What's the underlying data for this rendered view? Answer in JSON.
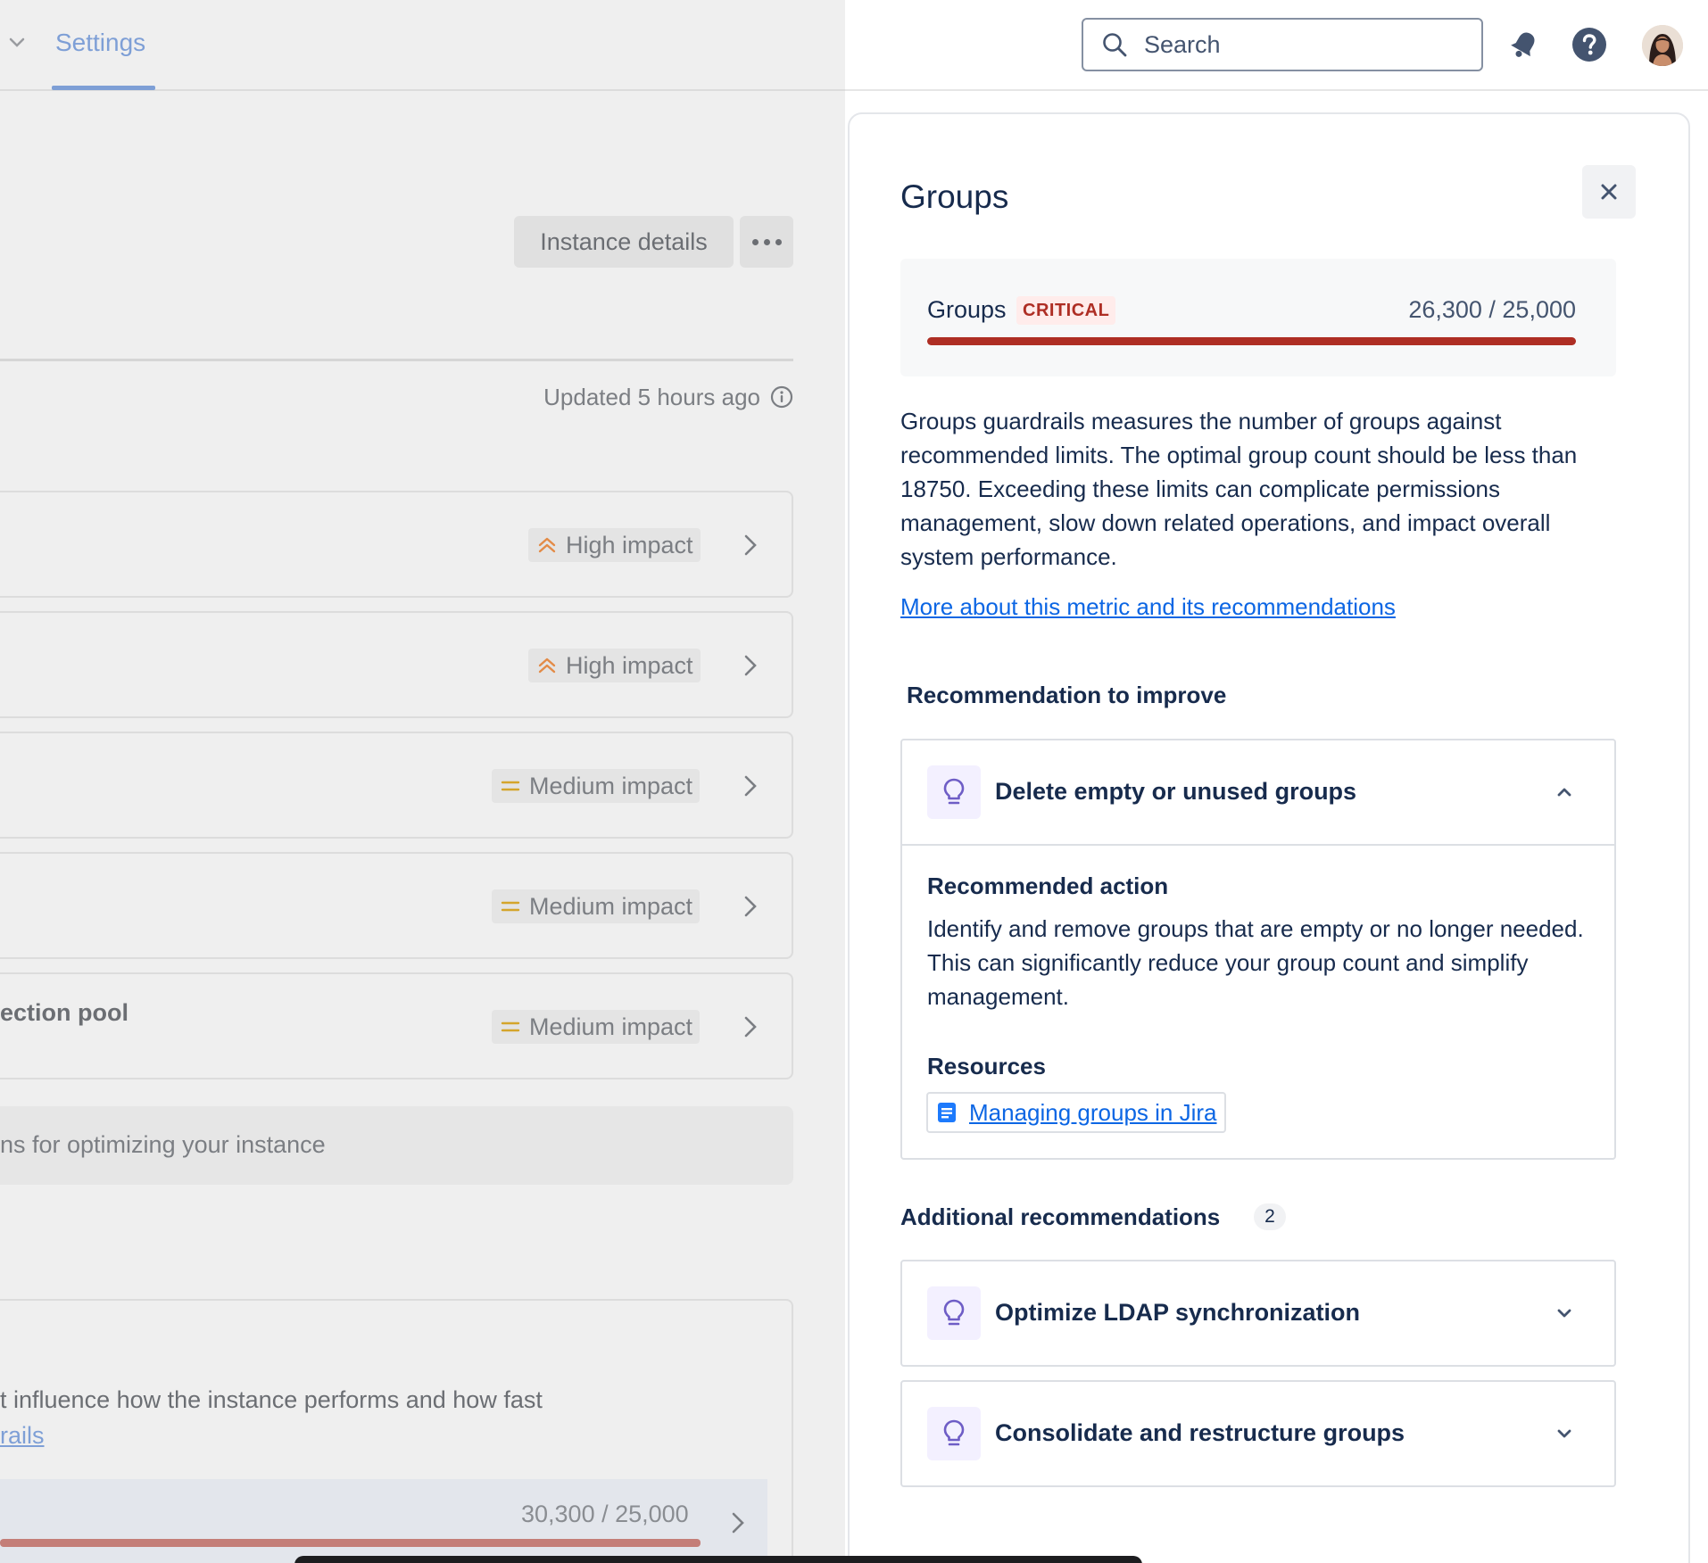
{
  "left_page": {
    "nav_tab": "Settings",
    "instance_details_button": "Instance details",
    "updated_text": "Updated 5 hours ago",
    "rows": [
      {
        "title": "",
        "impact": "High impact",
        "impact_level": "high"
      },
      {
        "title": "",
        "impact": "High impact",
        "impact_level": "high"
      },
      {
        "title": "",
        "impact": "Medium impact",
        "impact_level": "medium"
      },
      {
        "title": "",
        "impact": "Medium impact",
        "impact_level": "medium"
      },
      {
        "title": "ection pool",
        "impact": "Medium impact",
        "impact_level": "medium"
      }
    ],
    "tip_text": "ns for optimizing your instance",
    "bottom_text": "t influence how the instance performs and how fast",
    "bottom_link": "rails",
    "metric_value": "30,300 / 25,000",
    "metric_progress": 1.0
  },
  "header": {
    "search_placeholder": "Search",
    "icons": [
      "search-icon",
      "notification-bell-icon",
      "help-icon",
      "user-avatar"
    ]
  },
  "panel": {
    "title": "Groups",
    "metric": {
      "label": "Groups",
      "status": "CRITICAL",
      "value": "26,300 / 25,000",
      "progress": 1.0,
      "status_color": "#ae2e24"
    },
    "description": "Groups guardrails measures the number of groups against recommended limits. The optimal group count should be less than 18750. Exceeding these limits can complicate permissions management, slow down related operations, and impact overall system performance.",
    "more_link": "More about this metric and its recommendations",
    "recommendation_heading": "Recommendation to improve",
    "primary_recommendation": {
      "title": "Delete empty or unused groups",
      "expanded": true,
      "action_heading": "Recommended action",
      "action_text": "Identify and remove groups that are empty or no longer needed. This can significantly reduce your group count and simplify management.",
      "resources_heading": "Resources",
      "resource_link": "Managing groups in Jira"
    },
    "additional_heading": "Additional recommendations",
    "additional_count": "2",
    "additional": [
      {
        "title": "Optimize LDAP synchronization",
        "expanded": false
      },
      {
        "title": "Consolidate and restructure groups",
        "expanded": false
      }
    ]
  },
  "colors": {
    "accent": "#0c66e4",
    "critical": "#ae2e24",
    "high_impact": "#e38b47",
    "medium_impact": "#d4a52c",
    "bulb": "#6e5dc6"
  }
}
